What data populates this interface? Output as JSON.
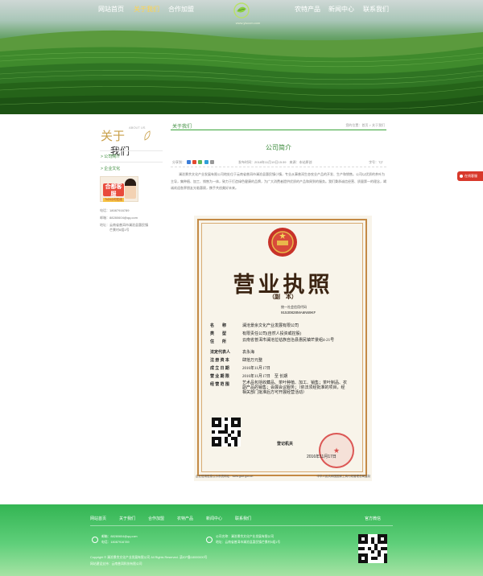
{
  "nav": {
    "items": [
      {
        "label": "网站首页",
        "active": false
      },
      {
        "label": "关于我们",
        "active": true
      },
      {
        "label": "合作加盟",
        "active": false
      },
      {
        "label": "农特产品",
        "active": false
      },
      {
        "label": "新闻中心",
        "active": false
      },
      {
        "label": "联系我们",
        "active": false
      }
    ],
    "logo_sub": "www.ylsccm.com"
  },
  "sidebar": {
    "title_1": "关于",
    "title_2": "我们",
    "title_en": "ABOUT US",
    "links": [
      "> 公司简介",
      "> 企业文化"
    ],
    "ad": {
      "text": "合都客服",
      "sub": "7x24小时在线"
    },
    "contact": [
      {
        "key": "电话：",
        "value": "18087916789"
      },
      {
        "key": "邮箱：",
        "value": "88280604@qq.com"
      },
      {
        "key": "地址：",
        "value": "云南省普洱市澜沧县惠民镇"
      },
      {
        "key": "",
        "value": "芒景村6组1号"
      }
    ]
  },
  "breadcrumb": {
    "title": "关于我们",
    "path": "您的位置：首页 > 关于我们"
  },
  "article": {
    "title": "公司简介",
    "share_label": "分享到：",
    "info": "发布时间：2018年11月19日15:39　来源：本站原创",
    "font_label": "字号：T|T",
    "paragraph": "澜沧景余文化产业发展有限公司地处位于云南省普洱市澜沧县惠民镇小镇，专业从事普洱生态农业产品的开发、生产和销售。公司以优质的茶叶为主导，集种植、加工、销售为一体，致力于打造绿色健康的品牌，为广大消费者提供优质的产品和周到的服务。我们秉承诚信经营、质量第一的理念，竭诚欢迎各界朋友光临惠顾，携手共创美好未来。"
  },
  "license": {
    "heading": "营业执照",
    "copy": "（副　本）",
    "code_label": "统一社会信用代码",
    "code": "91530828MA6N69KF",
    "rows": [
      {
        "key": "名　　称",
        "value": "澜沧景余文化产业发展有限公司"
      },
      {
        "key": "类　　型",
        "value": "有限责任公司(自然人投资或控股)"
      },
      {
        "key": "住　　所",
        "value": "云南省普洱市澜沧拉祜族自治县惠民镇芒景组4-21号"
      },
      {
        "key": "法定代表人",
        "value": "袁永海"
      },
      {
        "key": "注 册 资 本",
        "value": "肆拾万元整"
      },
      {
        "key": "成 立 日 期",
        "value": "2016年11月17日"
      },
      {
        "key": "营 业 期 限",
        "value": "2016年11月17日　至 长期"
      },
      {
        "key": "经 营 范 围",
        "value": "艺术品包括收藏品、茶叶种植、加工、销售；茶叶制品、农副产品的销售；会展会议服务；（依法须经批准的项目，经相关部门批准后方可开展经营活动）"
      }
    ],
    "reg_office": "登记机关",
    "reg_date": "2016年11月17日",
    "foot_left": "企业信用信息公示系统网址：www.gsxt.gov.cn",
    "foot_right": "中华人民共和国国家工商行政管理总局监制"
  },
  "float_button": "在线客服",
  "footer": {
    "nav": [
      "网站首页",
      "关于我们",
      "合作加盟",
      "农特产品",
      "新闻中心",
      "联系我们"
    ],
    "qr_label": "官方微信",
    "email": "邮箱：88280604@qq.com",
    "phone": "电话：18087916789",
    "company": "公司名称：澜沧景余文化产业发展有限公司",
    "address": "地址：云南省普洱市澜沧县惠民镇芒景村6组1号",
    "copyright": "Copyright © 澜沧景余文化产业发展有限公司 All Rights Reserved. 滇ICP备18000000号",
    "support": "网站建设支持：云南普洱科技有限公司"
  },
  "colors": {
    "accent": "#3a8a3a",
    "footer_top": "#33b553",
    "nav_active": "#ffd34d",
    "license_border": "#c48a45"
  }
}
